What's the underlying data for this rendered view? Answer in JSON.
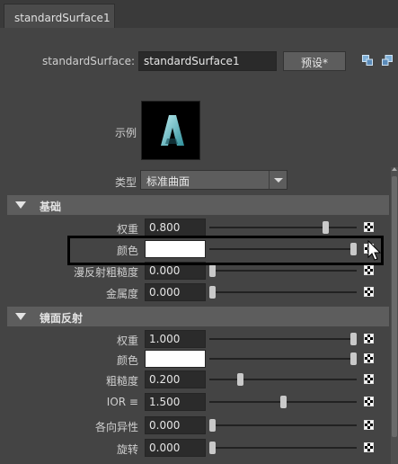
{
  "tab": {
    "label": "standardSurface1"
  },
  "header": {
    "node_type_label": "standardSurface:",
    "node_name": "standardSurface1",
    "preset_button": "预设*"
  },
  "sample": {
    "label": "示例"
  },
  "type": {
    "label": "类型",
    "value": "标准曲面"
  },
  "sections": {
    "base": {
      "title": "基础",
      "rows": [
        {
          "label": "权重",
          "value": "0.800",
          "slider": 0.8
        },
        {
          "label": "颜色",
          "value": "",
          "slider": 1.0,
          "color": "#ffffff"
        },
        {
          "label": "漫反射粗糙度",
          "value": "0.000",
          "slider": 0.0
        },
        {
          "label": "金属度",
          "value": "0.000",
          "slider": 0.0
        }
      ]
    },
    "specular": {
      "title": "镜面反射",
      "rows": [
        {
          "label": "权重",
          "value": "1.000",
          "slider": 1.0
        },
        {
          "label": "颜色",
          "value": "",
          "slider": 1.0,
          "color": "#ffffff"
        },
        {
          "label": "粗糙度",
          "value": "0.200",
          "slider": 0.2
        },
        {
          "label": "IOR ≡",
          "value": "1.500",
          "slider": 0.5
        },
        {
          "label": "各向异性",
          "value": "0.000",
          "slider": 0.0
        },
        {
          "label": "旋转",
          "value": "0.000",
          "slider": 0.0
        }
      ]
    }
  },
  "colors": {
    "background": "#444444",
    "section_header": "#5d5d5d",
    "field": "#2b2b2b"
  }
}
